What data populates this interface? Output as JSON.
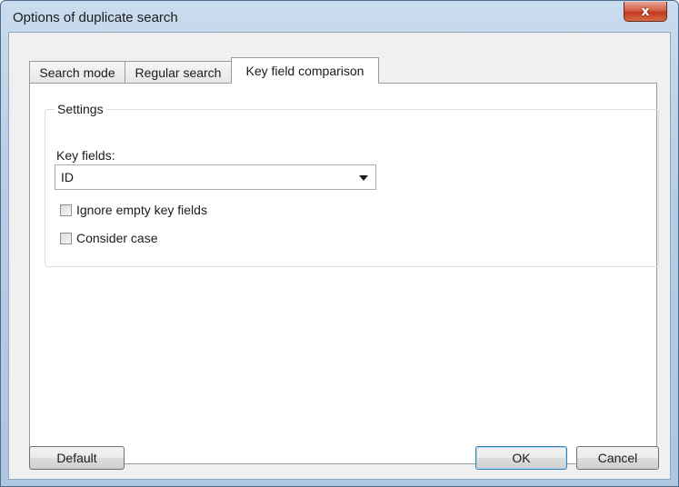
{
  "window": {
    "title": "Options of duplicate search",
    "close_glyph": "x"
  },
  "tabs": [
    {
      "label": "Search mode",
      "active": false
    },
    {
      "label": "Regular search",
      "active": false
    },
    {
      "label": "Key field comparison",
      "active": true
    }
  ],
  "settings": {
    "group_label": "Settings",
    "key_fields_label": "Key fields:",
    "key_fields_value": "ID",
    "checkboxes": [
      {
        "label": "Ignore empty key fields",
        "checked": false
      },
      {
        "label": "Consider case",
        "checked": false
      }
    ]
  },
  "buttons": {
    "default": "Default",
    "ok": "OK",
    "cancel": "Cancel"
  }
}
